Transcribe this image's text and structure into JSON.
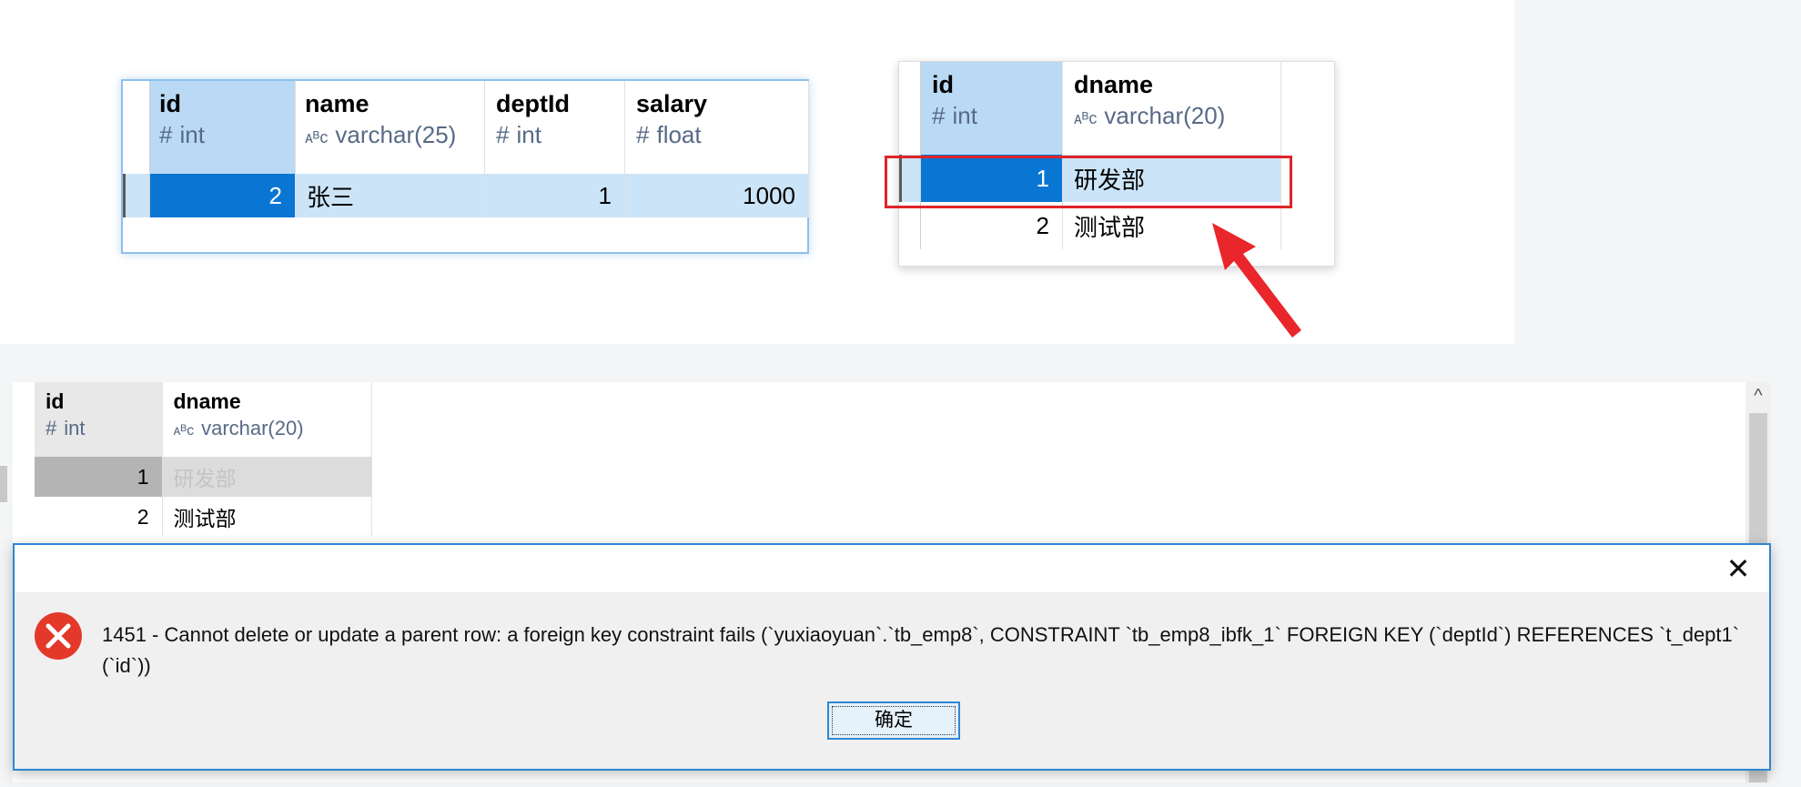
{
  "emp_grid": {
    "columns": [
      {
        "name": "id",
        "type": "int",
        "type_icon": "number-type-icon",
        "glyph": "#"
      },
      {
        "name": "name",
        "type": "varchar(25)",
        "type_icon": "text-type-icon",
        "glyph": "ᴀᴮᴄ"
      },
      {
        "name": "deptId",
        "type": "int",
        "type_icon": "number-type-icon",
        "glyph": "#"
      },
      {
        "name": "salary",
        "type": "float",
        "type_icon": "number-type-icon",
        "glyph": "#"
      }
    ],
    "rows": [
      {
        "id": "2",
        "name": "张三",
        "deptId": "1",
        "salary": "1000"
      }
    ]
  },
  "dept_grid": {
    "columns": [
      {
        "name": "id",
        "type": "int",
        "type_icon": "number-type-icon",
        "glyph": "#"
      },
      {
        "name": "dname",
        "type": "varchar(20)",
        "type_icon": "text-type-icon",
        "glyph": "ᴀᴮᴄ"
      }
    ],
    "rows": [
      {
        "id": "1",
        "dname": "研发部"
      },
      {
        "id": "2",
        "dname": "测试部"
      }
    ]
  },
  "bottom_grid": {
    "columns": [
      {
        "name": "id",
        "type": "int",
        "type_icon": "number-type-icon",
        "glyph": "#"
      },
      {
        "name": "dname",
        "type": "varchar(20)",
        "type_icon": "text-type-icon",
        "glyph": "ᴀᴮᴄ"
      }
    ],
    "rows": [
      {
        "id": "1",
        "dname": "研发部"
      },
      {
        "id": "2",
        "dname": "测试部"
      }
    ]
  },
  "scrollbar": {
    "up_glyph": "^"
  },
  "error_dialog": {
    "close_glyph": "✕",
    "message": "1451 - Cannot delete or update a parent row: a foreign key constraint fails (`yuxiaoyuan`.`tb_emp8`, CONSTRAINT `tb_emp8_ibfk_1` FOREIGN KEY (`deptId`) REFERENCES `t_dept1` (`id`))",
    "ok_label": "确定"
  },
  "colors": {
    "selection": "#0a76d3",
    "selected_row": "#cce4f7",
    "header_selected": "#b9d9f4",
    "highlight_box": "#e02428",
    "dialog_border": "#2f86d4",
    "error_icon": "#e3392b"
  }
}
